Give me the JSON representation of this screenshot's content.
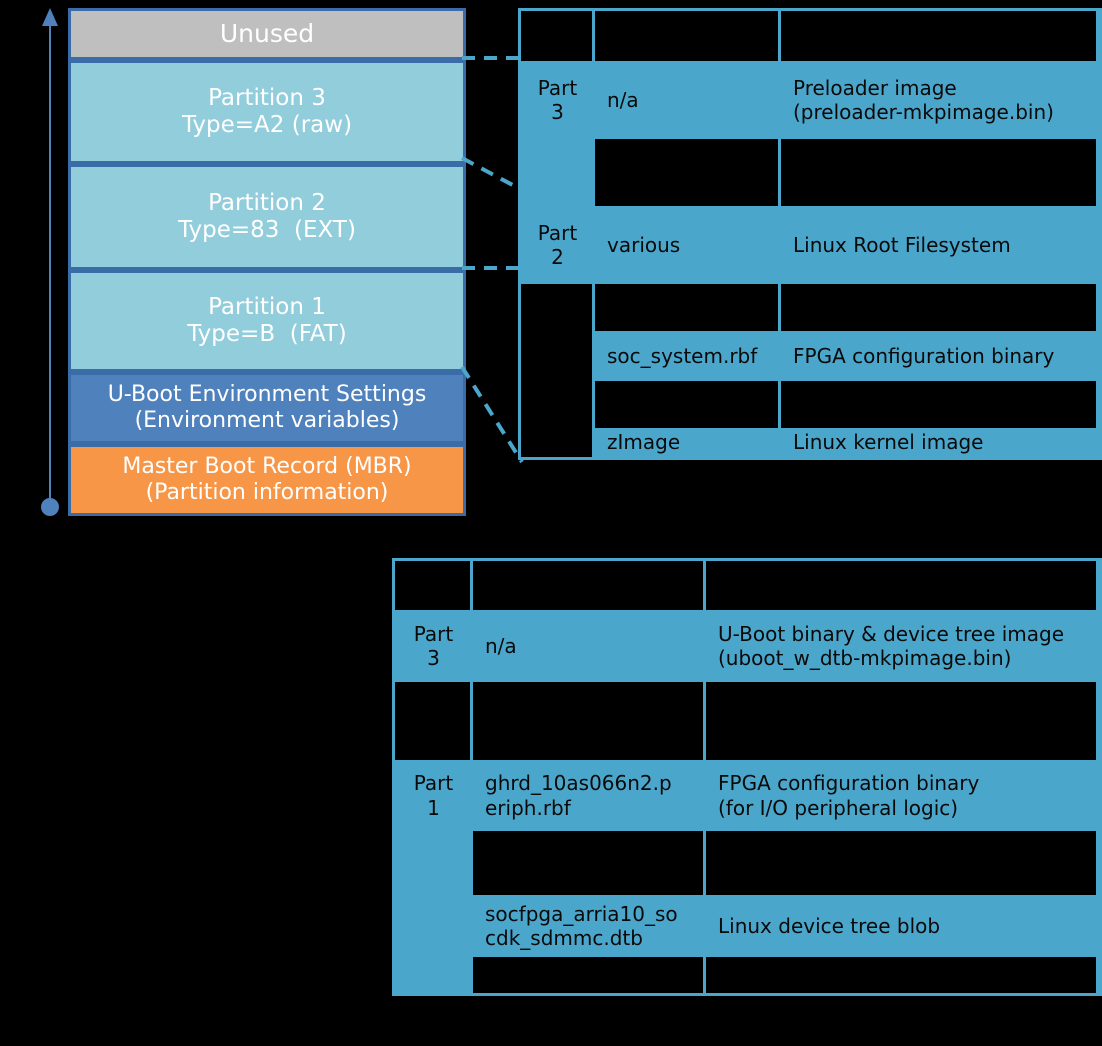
{
  "memory_map": {
    "blocks": [
      {
        "name": "unused",
        "lines": [
          "Unused"
        ]
      },
      {
        "name": "partition3",
        "lines": [
          "Partition 3",
          "Type=A2 (raw)"
        ]
      },
      {
        "name": "partition2",
        "lines": [
          "Partition 2",
          "Type=83  (EXT)"
        ]
      },
      {
        "name": "partition1",
        "lines": [
          "Partition 1",
          "Type=B  (FAT)"
        ]
      },
      {
        "name": "uboot-env",
        "lines": [
          "U-Boot Environment Settings",
          "(Environment variables)"
        ]
      },
      {
        "name": "mbr",
        "lines": [
          "Master Boot Record (MBR)",
          "(Partition information)"
        ]
      }
    ]
  },
  "colors": {
    "unused": "#BFBFBF",
    "partition": "#92CDDC",
    "uboot_env": "#4F81BD",
    "mbr": "#F79646",
    "block_border": "#3A6CA8",
    "table_fill": "#4BA6CB",
    "table_bg": "#000000",
    "arrow": "#4F81BD",
    "connector": "#4BA6CB"
  },
  "top_table": {
    "rows": [
      {
        "part": "",
        "file": "",
        "desc": "",
        "filled": false
      },
      {
        "part": "Part\n3",
        "file": "n/a",
        "desc": "Preloader image\n(preloader-mkpimage.bin)",
        "filled": true
      },
      {
        "part": "",
        "file": "",
        "desc": "",
        "filled": false
      },
      {
        "part": "Part\n2",
        "file": "various",
        "desc": "Linux Root  Filesystem",
        "filled": true
      },
      {
        "part": "",
        "file": "",
        "desc": "",
        "filled": false
      },
      {
        "part": "",
        "file": "soc_system.rbf",
        "desc": "FPGA configuration binary",
        "filled": true
      },
      {
        "part": "",
        "file": "",
        "desc": "",
        "filled": false
      },
      {
        "part": "",
        "file": "zImage",
        "desc": "Linux kernel image",
        "filled": true
      }
    ]
  },
  "bottom_table": {
    "rows": [
      {
        "part": "",
        "file": "",
        "desc": "",
        "filled": false
      },
      {
        "part": "Part\n3",
        "file": "n/a",
        "desc": "U-Boot binary & device tree image\n(uboot_w_dtb-mkpimage.bin)",
        "filled": true
      },
      {
        "part": "",
        "file": "",
        "desc": "",
        "filled": false
      },
      {
        "part": "Part\n1",
        "file": "ghrd_10as066n2.p\neriph.rbf",
        "desc": "FPGA configuration binary\n(for I/O peripheral logic)",
        "filled": true
      },
      {
        "part": "",
        "file": "",
        "desc": "",
        "filled": false
      },
      {
        "part": "",
        "file": "socfpga_arria10_so\ncdk_sdmmc.dtb",
        "desc": "Linux device tree blob",
        "filled": true
      },
      {
        "part": "",
        "file": "",
        "desc": "",
        "filled": false
      }
    ]
  }
}
